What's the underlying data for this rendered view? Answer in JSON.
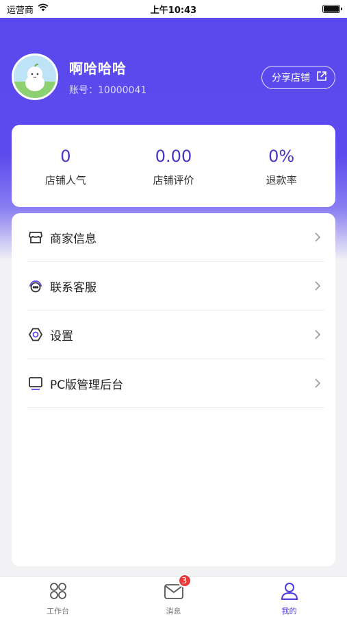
{
  "status_bar": {
    "carrier": "运营商",
    "time": "上午10:43"
  },
  "profile": {
    "name": "啊哈哈哈",
    "account": "账号：10000041"
  },
  "share_button": {
    "label": "分享店铺"
  },
  "stats": [
    {
      "value": "0",
      "label": "店铺人气"
    },
    {
      "value": "0.00",
      "label": "店铺评价"
    },
    {
      "value": "0%",
      "label": "退款率"
    }
  ],
  "menu": [
    {
      "label": "商家信息",
      "icon": "store-icon"
    },
    {
      "label": "联系客服",
      "icon": "headset-chat-icon"
    },
    {
      "label": "设置",
      "icon": "hex-nut-icon"
    },
    {
      "label": "PC版管理后台",
      "icon": "monitor-icon"
    }
  ],
  "tabbar": {
    "items": [
      {
        "label": "工作台",
        "icon": "grid-icon"
      },
      {
        "label": "消息",
        "icon": "mail-icon",
        "badge": "3"
      },
      {
        "label": "我的",
        "icon": "user-icon",
        "active": true
      }
    ]
  },
  "colors": {
    "accent": "#5a47ec",
    "stat_value": "#4536c9",
    "badge": "#e93a3a"
  }
}
